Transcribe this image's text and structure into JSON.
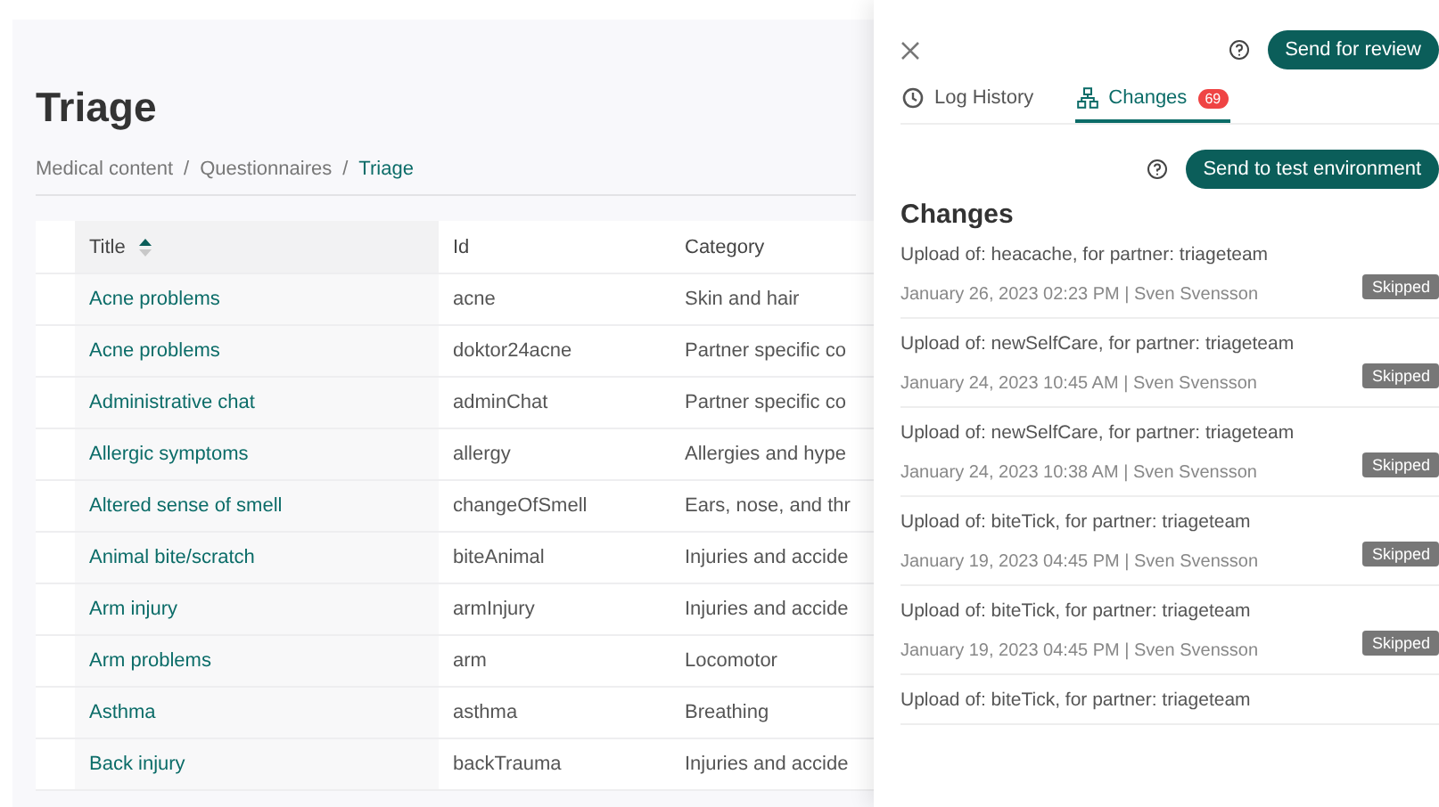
{
  "page": {
    "title": "Triage",
    "breadcrumb": [
      {
        "label": "Medical content",
        "selected": false
      },
      {
        "label": "Questionnaires",
        "selected": false
      },
      {
        "label": "Triage",
        "selected": true
      }
    ],
    "separator": "/"
  },
  "table": {
    "columns": [
      {
        "label": "Title",
        "sorted": true
      },
      {
        "label": "Id",
        "sorted": false
      },
      {
        "label": "Category",
        "sorted": false
      }
    ],
    "rows": [
      {
        "title": "Acne problems",
        "id": "acne",
        "category": "Skin and hair"
      },
      {
        "title": "Acne problems",
        "id": "doktor24acne",
        "category": "Partner specific co"
      },
      {
        "title": "Administrative chat",
        "id": "adminChat",
        "category": "Partner specific co"
      },
      {
        "title": "Allergic symptoms",
        "id": "allergy",
        "category": "Allergies and hype"
      },
      {
        "title": "Altered sense of smell",
        "id": "changeOfSmell",
        "category": "Ears, nose, and thr"
      },
      {
        "title": "Animal bite/scratch",
        "id": "biteAnimal",
        "category": "Injuries and accide"
      },
      {
        "title": "Arm injury",
        "id": "armInjury",
        "category": "Injuries and accide"
      },
      {
        "title": "Arm problems",
        "id": "arm",
        "category": "Locomotor"
      },
      {
        "title": "Asthma",
        "id": "asthma",
        "category": "Breathing"
      },
      {
        "title": "Back injury",
        "id": "backTrauma",
        "category": "Injuries and accide"
      }
    ]
  },
  "panel": {
    "primary_button": "Send for review",
    "tabs": [
      {
        "label": "Log History",
        "selected": false
      },
      {
        "label": "Changes",
        "selected": true,
        "badge": "69"
      }
    ],
    "secondary_button": "Send to test environment",
    "heading": "Changes",
    "changes": [
      {
        "text": "Upload of: heacache, for partner: triageteam",
        "meta": "January 26, 2023 02:23 PM | Sven Svensson",
        "status": "Skipped"
      },
      {
        "text": "Upload of: newSelfCare, for partner: triageteam",
        "meta": "January 24, 2023 10:45 AM | Sven Svensson",
        "status": "Skipped"
      },
      {
        "text": "Upload of: newSelfCare, for partner: triageteam",
        "meta": "January 24, 2023 10:38 AM | Sven Svensson",
        "status": "Skipped"
      },
      {
        "text": "Upload of: biteTick, for partner: triageteam",
        "meta": "January 19, 2023 04:45 PM | Sven Svensson",
        "status": "Skipped"
      },
      {
        "text": "Upload of: biteTick, for partner: triageteam",
        "meta": "January 19, 2023 04:45 PM | Sven Svensson",
        "status": "Skipped"
      },
      {
        "text": "Upload of: biteTick, for partner: triageteam"
      }
    ]
  }
}
